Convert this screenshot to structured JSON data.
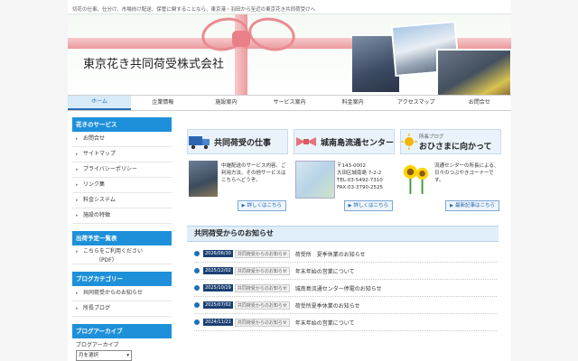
{
  "tagline": "切花の仕事、仕分け、市場向け配送、保管に関することなら、東京港・羽田から至近の東京花き共同荷受けへ",
  "company_name": "東京花き共同荷受株式会社",
  "nav": [
    "ホーム",
    "企業情報",
    "施設案内",
    "サービス案内",
    "料金案内",
    "アクセスマップ",
    "お問合せ"
  ],
  "sidebar": {
    "services_title": "花きのサービス",
    "services": [
      "お問合せ",
      "サイトマップ",
      "プライバシーポリシー",
      "リンク集",
      "料金システム",
      "施設の特徴"
    ],
    "schedule_title": "出荷予定一覧表",
    "schedule_link": "こちらをご利用ください",
    "schedule_note": "（PDF）",
    "category_title": "ブログカテゴリー",
    "categories": [
      "共同荷受からのお知らせ",
      "所長ブログ"
    ],
    "archive_title": "ブログアーカイブ",
    "archive_label": "ブログアーカイブ",
    "archive_select": "月を選択"
  },
  "panels": {
    "work": {
      "title": "共同荷受の仕事",
      "text": "中継配送のサービス内容、ご利用方法、その他サービスはこちらへどうぞ。",
      "button": "詳しくはこちら"
    },
    "center": {
      "title": "城南島流通センター",
      "text": "〒143-0002\n大田区城南島 7-2-2\nTEL:03-5492-7310\nFAX:03-3790-2525",
      "button": "詳しくはこちら"
    },
    "blog": {
      "label": "所長ブログ",
      "title": "おひさまに向かって",
      "text": "流通センターの所長による、日々のつぶやきコーナーです。",
      "button": "最新記事はこちら"
    }
  },
  "news": {
    "title": "共同荷受からのお知らせ",
    "items": [
      {
        "date": "2026/06/30",
        "category": "共同荷受からのお知らせ",
        "text": "荷受所　夏季休業のお知らせ"
      },
      {
        "date": "2025/12/02",
        "category": "共同荷受からのお知らせ",
        "text": "年末年始の営業について"
      },
      {
        "date": "2025/10/29",
        "category": "共同荷受からのお知らせ",
        "text": "城南島流通センター停電のお知らせ"
      },
      {
        "date": "2025/07/02",
        "category": "共同荷受からのお知らせ",
        "text": "荷受所夏季休業のお知らせ"
      },
      {
        "date": "2024/11/21",
        "category": "共同荷受からのお知らせ",
        "text": "年末年始の営業について"
      }
    ]
  }
}
